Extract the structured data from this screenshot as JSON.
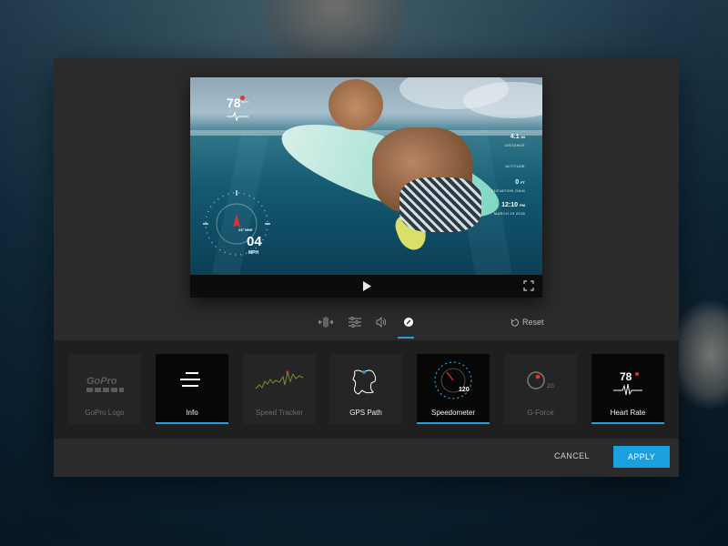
{
  "colors": {
    "accent": "#1a9fe0",
    "modal_bg": "#2b2b2b",
    "tray_bg": "#1f1f1f",
    "hud_red": "#e5312f"
  },
  "preview": {
    "hud": {
      "temperature": "78",
      "temperature_unit": "bpm",
      "distance": "4.1",
      "distance_unit": "MI",
      "distance_label": "DISTANCE",
      "altitude_label": "ALTITUDE",
      "elevation_gain": "0",
      "elevation_gain_unit": "FT",
      "elevation_gain_label": "ELEVATION GAIN",
      "time": "12:10",
      "time_unit": "PM",
      "date": "MARCH 19 2016",
      "speed": "04",
      "speed_unit": "MPH",
      "heading": "23° NNE"
    },
    "controls": {
      "play_icon": "play-icon",
      "fullscreen_icon": "fullscreen-icon"
    }
  },
  "toolbar": {
    "tools": [
      "trim-icon",
      "adjust-icon",
      "volume-icon",
      "gauges-icon"
    ],
    "active_tool": "gauges-icon",
    "reset_label": "Reset"
  },
  "overlays": [
    {
      "label": "GoPro Logo",
      "state": "inactive"
    },
    {
      "label": "Info",
      "state": "selected"
    },
    {
      "label": "Speed Tracker",
      "state": "inactive"
    },
    {
      "label": "GPS Path",
      "state": "available"
    },
    {
      "label": "Speedometer",
      "state": "selected"
    },
    {
      "label": "G-Force",
      "state": "inactive"
    },
    {
      "label": "Heart Rate",
      "state": "selected"
    }
  ],
  "tile_art": {
    "gopro_logo_text": "GoPro",
    "speedometer_value": "120",
    "gforce_value": "2G",
    "heart_rate_value": "78"
  },
  "footer": {
    "cancel_label": "CANCEL",
    "apply_label": "APPLY"
  }
}
